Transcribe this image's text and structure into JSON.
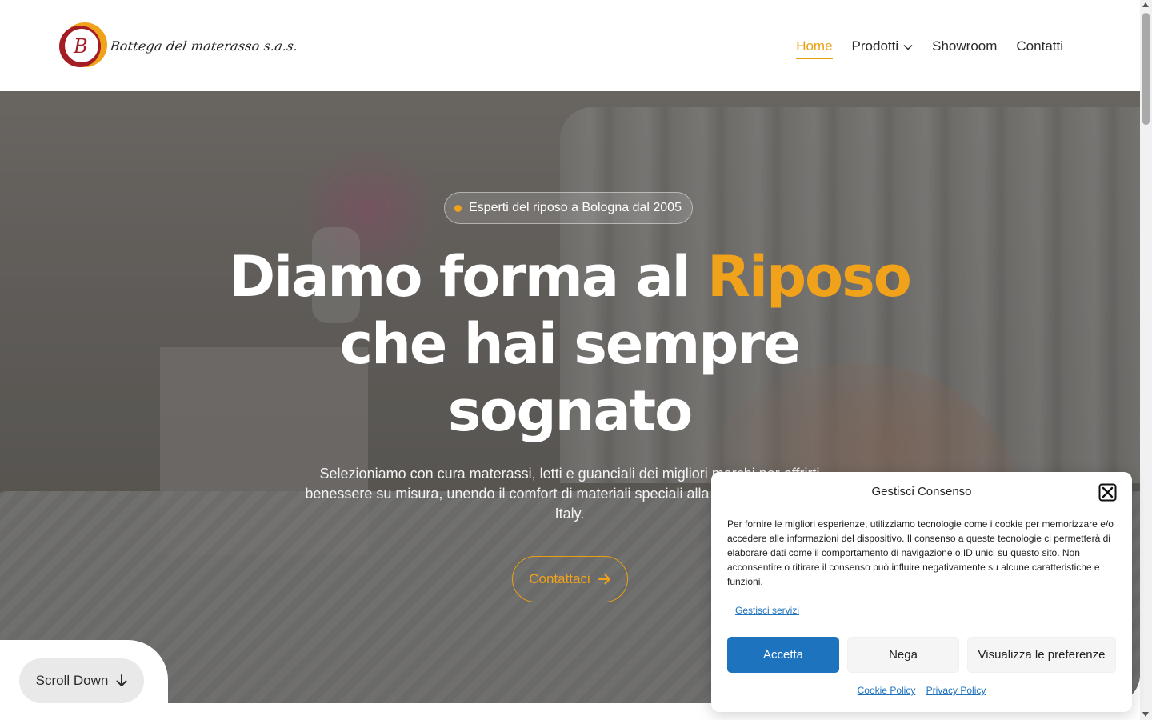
{
  "header": {
    "logo_text": "Bottega del materasso s.a.s.",
    "logo_letter": "B",
    "nav": [
      {
        "label": "Home",
        "active": true
      },
      {
        "label": "Prodotti",
        "has_dropdown": true
      },
      {
        "label": "Showroom"
      },
      {
        "label": "Contatti"
      }
    ]
  },
  "hero": {
    "badge": "Esperti del riposo a Bologna dal 2005",
    "headline_part1": "Diamo forma al ",
    "headline_highlight": "Riposo",
    "headline_line2": "che hai sempre",
    "headline_line3": "sognato",
    "subtext": "Selezioniamo con cura materassi, letti e guanciali dei migliori marchi per offrirti benessere su misura, unendo il comfort di materiali speciali alla qualità del Made in Italy.",
    "cta_label": "Contattaci",
    "scroll_label": "Scroll Down"
  },
  "consent": {
    "title": "Gestisci Consenso",
    "body": "Per fornire le migliori esperienze, utilizziamo tecnologie come i cookie per memorizzare e/o accedere alle informazioni del dispositivo. Il consenso a queste tecnologie ci permetterà di elaborare dati come il comportamento di navigazione o ID unici su questo sito. Non acconsentire o ritirare il consenso può influire negativamente su alcune caratteristiche e funzioni.",
    "manage_services": "Gestisci servizi",
    "accept": "Accetta",
    "deny": "Nega",
    "preferences": "Visualizza le preferenze",
    "cookie_policy": "Cookie Policy",
    "privacy_policy": "Privacy Policy"
  },
  "colors": {
    "accent": "#f0a21b",
    "link": "#1e73be",
    "accept_button": "#1e73be"
  },
  "icons": {
    "dropdown": "chevron-down-icon",
    "cta": "arrow-right-icon",
    "scroll": "arrow-down-icon",
    "close": "close-icon",
    "badge": "dot-icon"
  }
}
